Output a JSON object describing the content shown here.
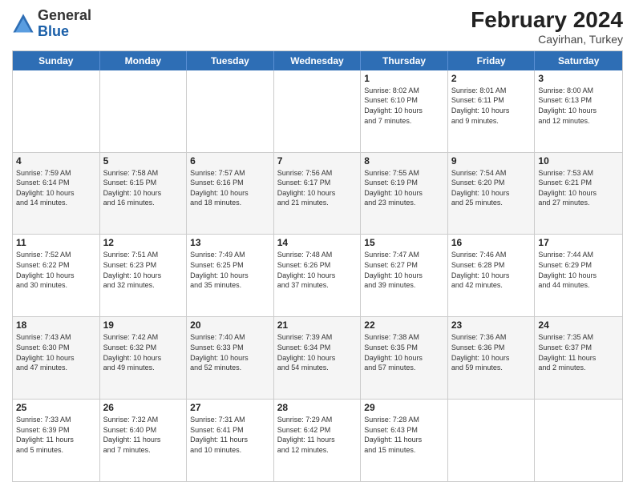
{
  "header": {
    "logo_general": "General",
    "logo_blue": "Blue",
    "month_year": "February 2024",
    "location": "Cayirhan, Turkey"
  },
  "days_of_week": [
    "Sunday",
    "Monday",
    "Tuesday",
    "Wednesday",
    "Thursday",
    "Friday",
    "Saturday"
  ],
  "weeks": [
    [
      {
        "day": "",
        "info": ""
      },
      {
        "day": "",
        "info": ""
      },
      {
        "day": "",
        "info": ""
      },
      {
        "day": "",
        "info": ""
      },
      {
        "day": "1",
        "info": "Sunrise: 8:02 AM\nSunset: 6:10 PM\nDaylight: 10 hours\nand 7 minutes."
      },
      {
        "day": "2",
        "info": "Sunrise: 8:01 AM\nSunset: 6:11 PM\nDaylight: 10 hours\nand 9 minutes."
      },
      {
        "day": "3",
        "info": "Sunrise: 8:00 AM\nSunset: 6:13 PM\nDaylight: 10 hours\nand 12 minutes."
      }
    ],
    [
      {
        "day": "4",
        "info": "Sunrise: 7:59 AM\nSunset: 6:14 PM\nDaylight: 10 hours\nand 14 minutes."
      },
      {
        "day": "5",
        "info": "Sunrise: 7:58 AM\nSunset: 6:15 PM\nDaylight: 10 hours\nand 16 minutes."
      },
      {
        "day": "6",
        "info": "Sunrise: 7:57 AM\nSunset: 6:16 PM\nDaylight: 10 hours\nand 18 minutes."
      },
      {
        "day": "7",
        "info": "Sunrise: 7:56 AM\nSunset: 6:17 PM\nDaylight: 10 hours\nand 21 minutes."
      },
      {
        "day": "8",
        "info": "Sunrise: 7:55 AM\nSunset: 6:19 PM\nDaylight: 10 hours\nand 23 minutes."
      },
      {
        "day": "9",
        "info": "Sunrise: 7:54 AM\nSunset: 6:20 PM\nDaylight: 10 hours\nand 25 minutes."
      },
      {
        "day": "10",
        "info": "Sunrise: 7:53 AM\nSunset: 6:21 PM\nDaylight: 10 hours\nand 27 minutes."
      }
    ],
    [
      {
        "day": "11",
        "info": "Sunrise: 7:52 AM\nSunset: 6:22 PM\nDaylight: 10 hours\nand 30 minutes."
      },
      {
        "day": "12",
        "info": "Sunrise: 7:51 AM\nSunset: 6:23 PM\nDaylight: 10 hours\nand 32 minutes."
      },
      {
        "day": "13",
        "info": "Sunrise: 7:49 AM\nSunset: 6:25 PM\nDaylight: 10 hours\nand 35 minutes."
      },
      {
        "day": "14",
        "info": "Sunrise: 7:48 AM\nSunset: 6:26 PM\nDaylight: 10 hours\nand 37 minutes."
      },
      {
        "day": "15",
        "info": "Sunrise: 7:47 AM\nSunset: 6:27 PM\nDaylight: 10 hours\nand 39 minutes."
      },
      {
        "day": "16",
        "info": "Sunrise: 7:46 AM\nSunset: 6:28 PM\nDaylight: 10 hours\nand 42 minutes."
      },
      {
        "day": "17",
        "info": "Sunrise: 7:44 AM\nSunset: 6:29 PM\nDaylight: 10 hours\nand 44 minutes."
      }
    ],
    [
      {
        "day": "18",
        "info": "Sunrise: 7:43 AM\nSunset: 6:30 PM\nDaylight: 10 hours\nand 47 minutes."
      },
      {
        "day": "19",
        "info": "Sunrise: 7:42 AM\nSunset: 6:32 PM\nDaylight: 10 hours\nand 49 minutes."
      },
      {
        "day": "20",
        "info": "Sunrise: 7:40 AM\nSunset: 6:33 PM\nDaylight: 10 hours\nand 52 minutes."
      },
      {
        "day": "21",
        "info": "Sunrise: 7:39 AM\nSunset: 6:34 PM\nDaylight: 10 hours\nand 54 minutes."
      },
      {
        "day": "22",
        "info": "Sunrise: 7:38 AM\nSunset: 6:35 PM\nDaylight: 10 hours\nand 57 minutes."
      },
      {
        "day": "23",
        "info": "Sunrise: 7:36 AM\nSunset: 6:36 PM\nDaylight: 10 hours\nand 59 minutes."
      },
      {
        "day": "24",
        "info": "Sunrise: 7:35 AM\nSunset: 6:37 PM\nDaylight: 11 hours\nand 2 minutes."
      }
    ],
    [
      {
        "day": "25",
        "info": "Sunrise: 7:33 AM\nSunset: 6:39 PM\nDaylight: 11 hours\nand 5 minutes."
      },
      {
        "day": "26",
        "info": "Sunrise: 7:32 AM\nSunset: 6:40 PM\nDaylight: 11 hours\nand 7 minutes."
      },
      {
        "day": "27",
        "info": "Sunrise: 7:31 AM\nSunset: 6:41 PM\nDaylight: 11 hours\nand 10 minutes."
      },
      {
        "day": "28",
        "info": "Sunrise: 7:29 AM\nSunset: 6:42 PM\nDaylight: 11 hours\nand 12 minutes."
      },
      {
        "day": "29",
        "info": "Sunrise: 7:28 AM\nSunset: 6:43 PM\nDaylight: 11 hours\nand 15 minutes."
      },
      {
        "day": "",
        "info": ""
      },
      {
        "day": "",
        "info": ""
      }
    ]
  ]
}
